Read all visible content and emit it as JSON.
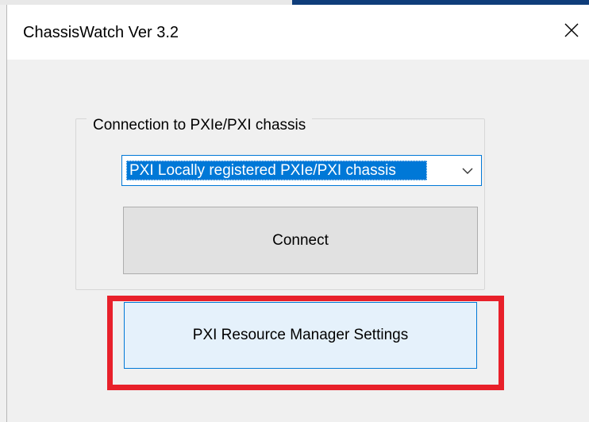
{
  "window": {
    "title": "ChassisWatch Ver 3.2",
    "close_icon": "close-icon"
  },
  "connection_group": {
    "label": "Connection to PXIe/PXI chassis",
    "combo_selected": "PXI Locally registered PXIe/PXI chassis",
    "dropdown_icon": "chevron-down-icon",
    "connect_label": "Connect"
  },
  "settings": {
    "label": "PXI Resource Manager Settings"
  },
  "colors": {
    "accent": "#0078d7",
    "highlight": "#e8202a",
    "button_face": "#e1e1e1",
    "hover_face": "#e5f1fb"
  }
}
